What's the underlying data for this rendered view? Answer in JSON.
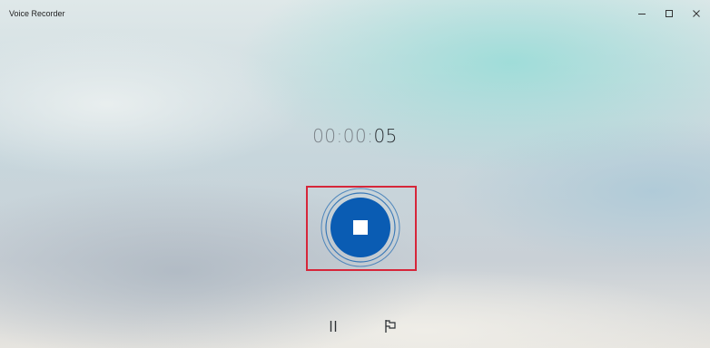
{
  "window": {
    "title": "Voice Recorder",
    "controls": {
      "minimize_icon": "minimize-icon",
      "maximize_icon": "maximize-icon",
      "close_icon": "close-icon"
    }
  },
  "timer": {
    "hours_minutes": "00:00:",
    "seconds": "05"
  },
  "recording": {
    "stop_icon": "stop-icon",
    "highlight_color": "#d6263a",
    "button_color": "#0a5cb3"
  },
  "controls": {
    "pause_icon": "pause-icon",
    "flag_icon": "flag-icon"
  }
}
